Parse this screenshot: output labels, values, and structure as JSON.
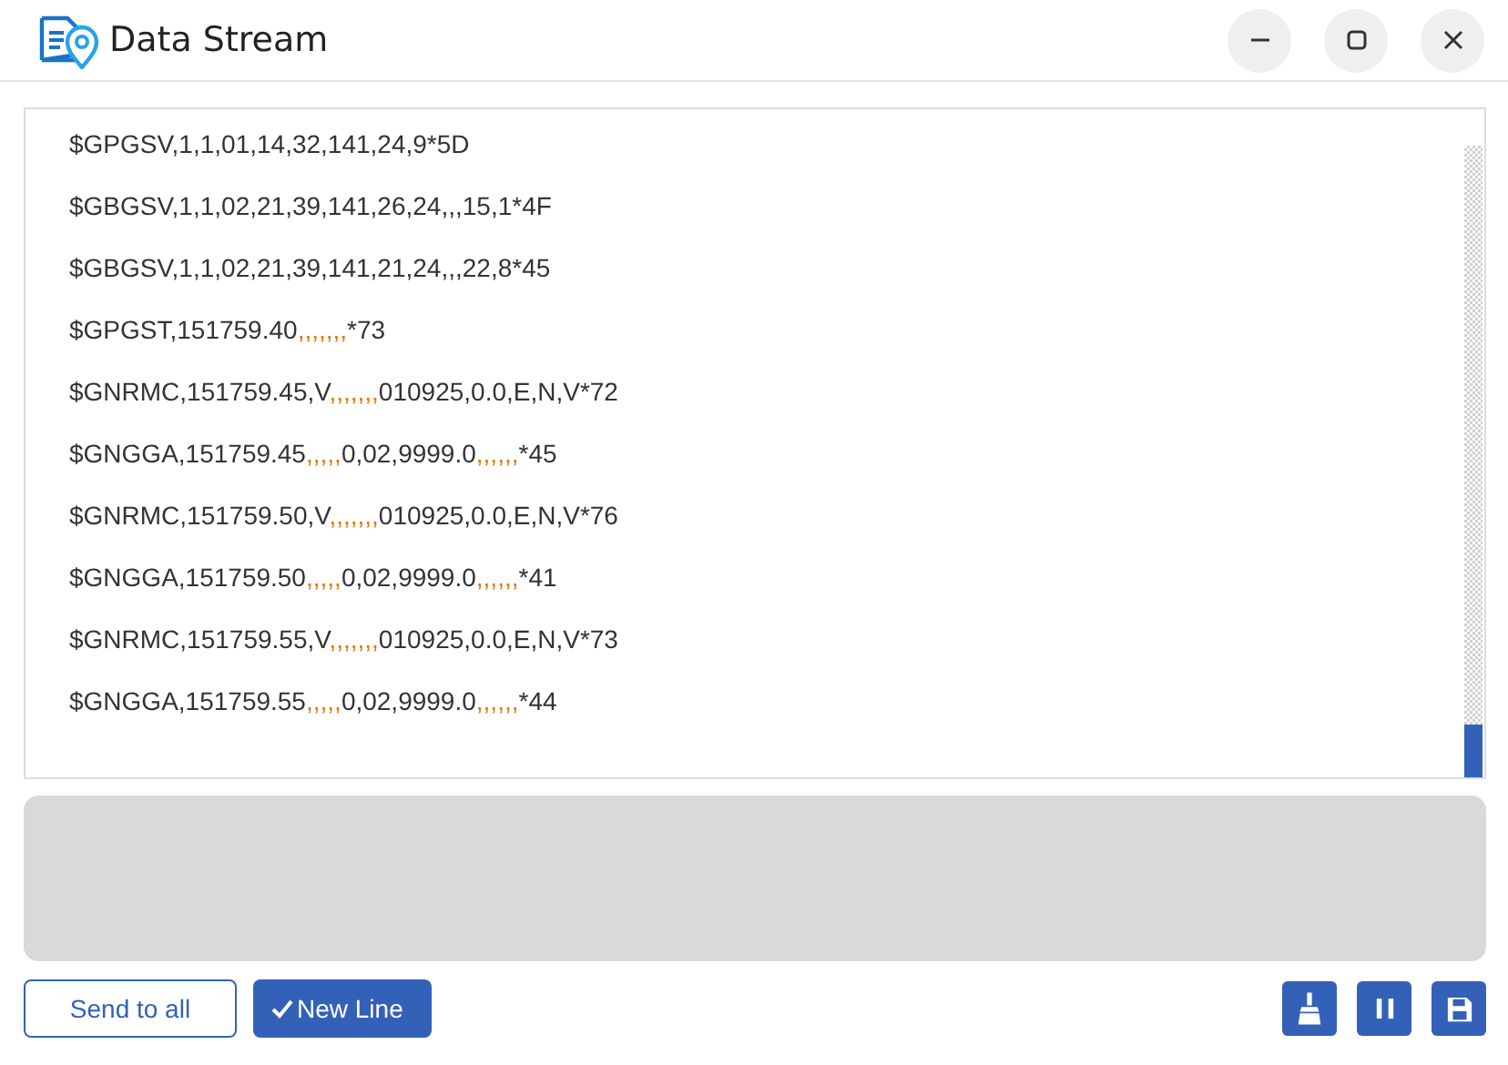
{
  "window": {
    "title": "Data Stream"
  },
  "log": {
    "lines": [
      [
        {
          "text": "$GPGSV,1,1,01,14,32,141,24,9*5D",
          "kind": "data"
        }
      ],
      [
        {
          "text": "$GBGSV,1,1,02,21,39,141,26,24,,,15,1*4F",
          "kind": "data"
        }
      ],
      [
        {
          "text": "$GBGSV,1,1,02,21,39,141,21,24,,,22,8*45",
          "kind": "data"
        }
      ],
      [
        {
          "text": "$GPGST,151759.40",
          "kind": "data"
        },
        {
          "text": ",,,,,,,",
          "kind": "empty"
        },
        {
          "text": "*73",
          "kind": "data"
        }
      ],
      [
        {
          "text": "$GNRMC,151759.45,V",
          "kind": "data"
        },
        {
          "text": ",,,,,,,",
          "kind": "empty"
        },
        {
          "text": "010925,0.0,E,N,V*72",
          "kind": "data"
        }
      ],
      [
        {
          "text": "$GNGGA,151759.45",
          "kind": "data"
        },
        {
          "text": ",,,,,",
          "kind": "empty"
        },
        {
          "text": "0,02,9999.0",
          "kind": "data"
        },
        {
          "text": ",,,,,,",
          "kind": "empty"
        },
        {
          "text": "*45",
          "kind": "data"
        }
      ],
      [
        {
          "text": "$GNRMC,151759.50,V",
          "kind": "data"
        },
        {
          "text": ",,,,,,,",
          "kind": "empty"
        },
        {
          "text": "010925,0.0,E,N,V*76",
          "kind": "data"
        }
      ],
      [
        {
          "text": "$GNGGA,151759.50",
          "kind": "data"
        },
        {
          "text": ",,,,,",
          "kind": "empty"
        },
        {
          "text": "0,02,9999.0",
          "kind": "data"
        },
        {
          "text": ",,,,,,",
          "kind": "empty"
        },
        {
          "text": "*41",
          "kind": "data"
        }
      ],
      [
        {
          "text": "$GNRMC,151759.55,V",
          "kind": "data"
        },
        {
          "text": ",,,,,,,",
          "kind": "empty"
        },
        {
          "text": "010925,0.0,E,N,V*73",
          "kind": "data"
        }
      ],
      [
        {
          "text": "$GNGGA,151759.55",
          "kind": "data"
        },
        {
          "text": ",,,,,",
          "kind": "empty"
        },
        {
          "text": "0,02,9999.0",
          "kind": "data"
        },
        {
          "text": ",,,,,,",
          "kind": "empty"
        },
        {
          "text": "*44",
          "kind": "data"
        }
      ]
    ]
  },
  "buttons": {
    "send_all": "Send to all",
    "new_line": {
      "label": "New Line",
      "checked": true
    }
  }
}
